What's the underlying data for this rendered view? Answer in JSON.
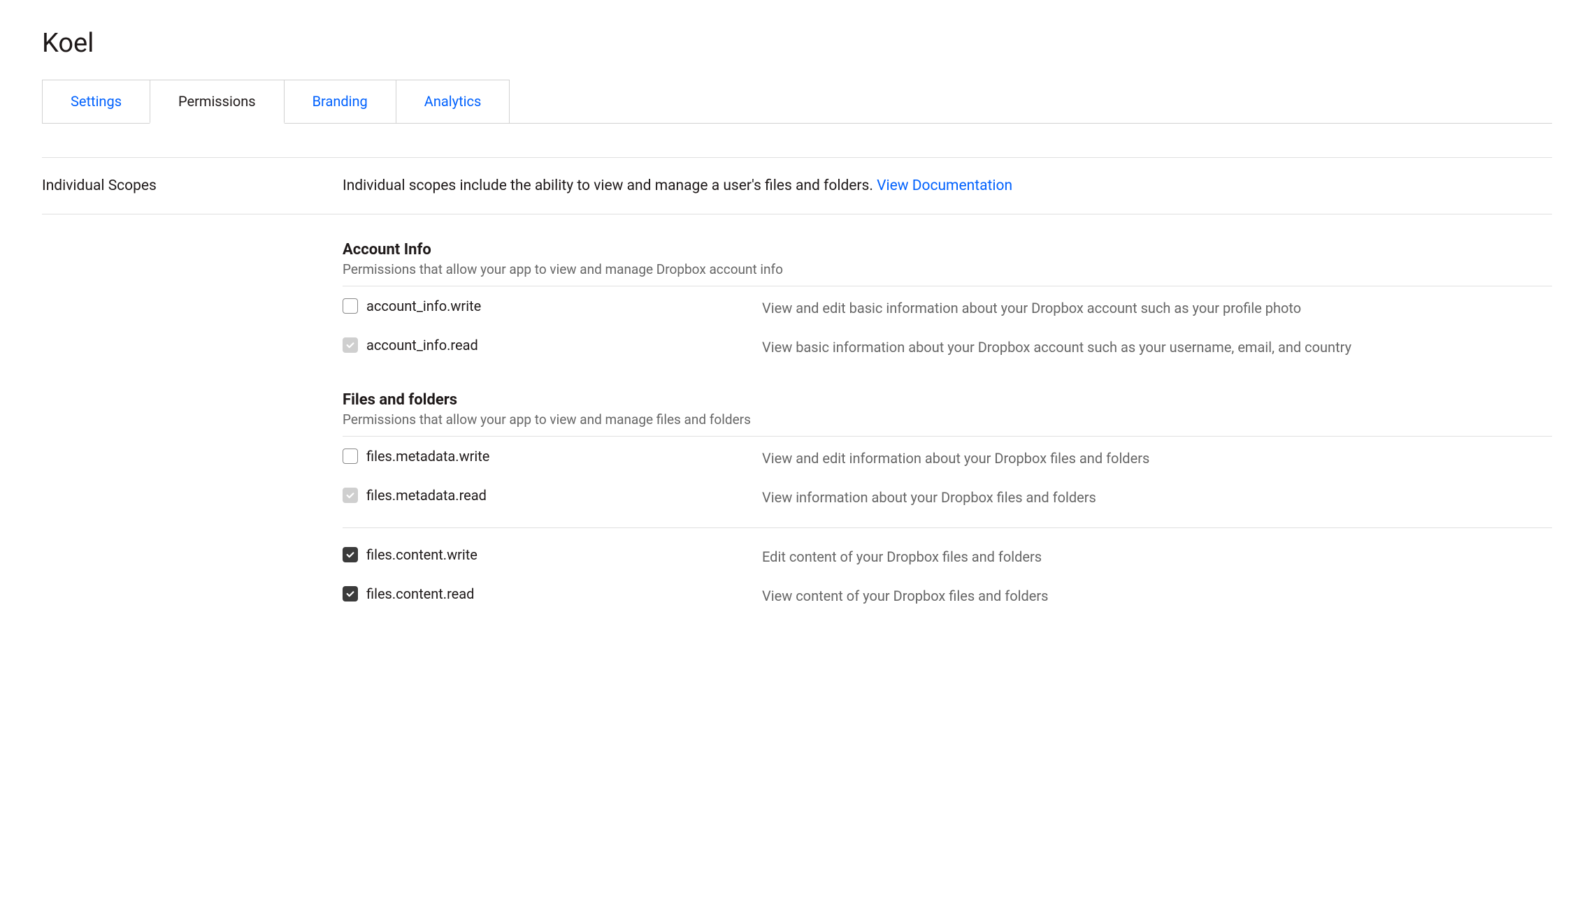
{
  "page": {
    "title": "Koel"
  },
  "tabs": {
    "settings": "Settings",
    "permissions": "Permissions",
    "branding": "Branding",
    "analytics": "Analytics"
  },
  "scopes": {
    "label": "Individual Scopes",
    "description": "Individual scopes include the ability to view and manage a user's files and folders. ",
    "doc_link": "View Documentation"
  },
  "groups": {
    "account_info": {
      "title": "Account Info",
      "desc": "Permissions that allow your app to view and manage Dropbox account info",
      "items": {
        "write": {
          "name": "account_info.write",
          "desc": "View and edit basic information about your Dropbox account such as your profile photo"
        },
        "read": {
          "name": "account_info.read",
          "desc": "View basic information about your Dropbox account such as your username, email, and country"
        }
      }
    },
    "files_folders": {
      "title": "Files and folders",
      "desc": "Permissions that allow your app to view and manage files and folders",
      "items": {
        "metadata_write": {
          "name": "files.metadata.write",
          "desc": "View and edit information about your Dropbox files and folders"
        },
        "metadata_read": {
          "name": "files.metadata.read",
          "desc": "View information about your Dropbox files and folders"
        },
        "content_write": {
          "name": "files.content.write",
          "desc": "Edit content of your Dropbox files and folders"
        },
        "content_read": {
          "name": "files.content.read",
          "desc": "View content of your Dropbox files and folders"
        }
      }
    }
  }
}
